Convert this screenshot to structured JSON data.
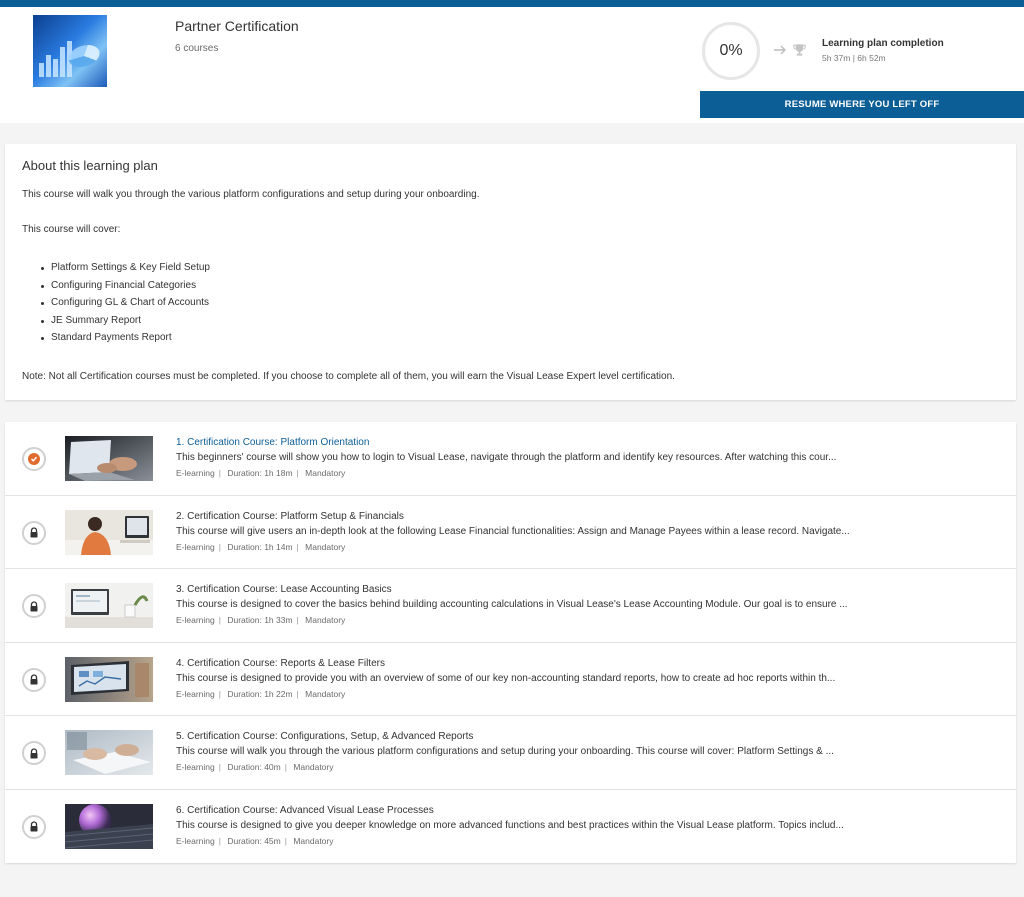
{
  "header": {
    "title": "Partner Certification",
    "course_count": "6 courses",
    "progress": "0%",
    "progress_value": 0,
    "completion_label": "Learning plan completion",
    "completion_time": "5h 37m | 6h 52m",
    "resume_label": "RESUME WHERE YOU LEFT OFF"
  },
  "about": {
    "title": "About this learning plan",
    "intro": "This course will walk you through the various platform configurations and setup during your onboarding.",
    "cover_intro": "This course will cover:",
    "items": [
      "Platform Settings & Key Field Setup",
      "Configuring Financial Categories",
      "Configuring GL & Chart of Accounts",
      "JE Summary Report",
      "Standard Payments Report"
    ],
    "note": "Note: Not all Certification courses must be completed. If you choose to complete all of them, you will earn the Visual Lease Expert level certification."
  },
  "courses": [
    {
      "title": "1. Certification Course: Platform Orientation",
      "description": "This beginners' course will show you how to login to Visual Lease, navigate through the platform and identify key resources. After watching this cour...",
      "type": "E-learning",
      "duration": "Duration: 1h 18m",
      "requirement": "Mandatory",
      "status": "in-progress"
    },
    {
      "title": "2. Certification Course: Platform Setup & Financials",
      "description": "This course will give users an in-depth look at the following Lease Financial functionalities: Assign and Manage Payees within a lease record. Navigate...",
      "type": "E-learning",
      "duration": "Duration: 1h 14m",
      "requirement": "Mandatory",
      "status": "locked"
    },
    {
      "title": "3. Certification Course: Lease Accounting Basics",
      "description": "This course is designed to cover the basics behind building accounting calculations in Visual Lease's Lease Accounting Module. Our goal is to ensure ...",
      "type": "E-learning",
      "duration": "Duration: 1h 33m",
      "requirement": "Mandatory",
      "status": "locked"
    },
    {
      "title": "4. Certification Course: Reports & Lease Filters",
      "description": "This course is designed to provide you with an overview of some of our key non-accounting standard reports, how to create ad hoc reports within th...",
      "type": "E-learning",
      "duration": "Duration: 1h 22m",
      "requirement": "Mandatory",
      "status": "locked"
    },
    {
      "title": "5. Certification Course: Configurations, Setup, & Advanced Reports",
      "description": "This course will walk you through the various platform configurations and setup during your onboarding. This course will cover: Platform Settings & ...",
      "type": "E-learning",
      "duration": "Duration: 40m",
      "requirement": "Mandatory",
      "status": "locked"
    },
    {
      "title": "6. Certification Course: Advanced Visual Lease Processes",
      "description": "This course is designed to give you deeper knowledge on more advanced functions and best practices within the Visual Lease platform. Topics includ...",
      "type": "E-learning",
      "duration": "Duration: 45m",
      "requirement": "Mandatory",
      "status": "locked"
    }
  ],
  "colors": {
    "brand": "#0c5e97",
    "in_progress": "#e06b2c",
    "locked_ring": "#d0d0d0"
  }
}
